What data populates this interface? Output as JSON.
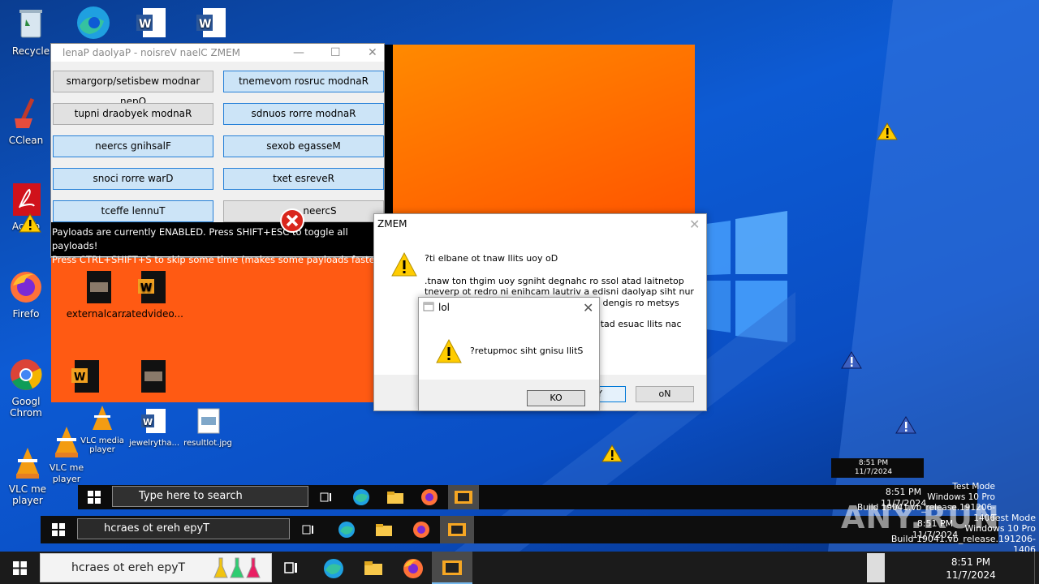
{
  "desktop": {
    "icons": [
      {
        "label": "Recycle"
      },
      {
        "label": "CClean"
      },
      {
        "label": "Acrob"
      },
      {
        "label": "Firefo"
      },
      {
        "label": "Googl Chrom"
      },
      {
        "label": "VLC me player"
      },
      {
        "label": "VLC me player"
      },
      {
        "label": "VLC media player"
      },
      {
        "label": "jewelrytha..."
      },
      {
        "label": "resultlot.jpg"
      }
    ],
    "panel_icons": [
      {
        "label": "externalcar..."
      },
      {
        "label": "ratedvideo..."
      }
    ]
  },
  "panel_window": {
    "title": "lenaP daolyaP - noisreV naelC ZMEM",
    "buttons": [
      "smargorp/setisbew modnar nepO",
      "tnemevom rosruc modnaR",
      "tupni draobyek modnaR",
      "sdnuos rorre modnaR",
      "neercs gnihsalF",
      "sexob egasseM",
      "snoci rorre warD",
      "txet esreveR",
      "tceffe lennuT",
      "neercS"
    ],
    "status_line1": "Payloads are currently ENABLED. Press SHIFT+ESC to toggle all payloads!",
    "status_line2": "Press CTRL+SHIFT+S to skip some time (makes some payloads faster)"
  },
  "memz_dialog": {
    "title": "ZMEM",
    "line1": "?ti elbane ot tnaw llits uoy oD",
    "line2": ".tnaw ton thgim uoy sgniht degnahc ro ssol atad laitnetop",
    "line3": "tneverp ot redro ni enihcam lautriv a edisni daolyap siht nur",
    "line4": "ni dengis ro metsys",
    "line5": "atad esuac llits nac",
    "yes_fragment": "Y",
    "no_label": "oN"
  },
  "lol_dialog": {
    "title": "lol",
    "message": "?retupmoc siht gnisu llitS",
    "ok_label": "KO"
  },
  "taskbars": [
    {
      "search": "Type here to search",
      "time": "8:51 PM",
      "date": "11/7/2024"
    },
    {
      "search": "hcraes ot ereh epyT",
      "time": "8:51 PM",
      "date": "11/7/2024"
    },
    {
      "search": "hcraes ot ereh epyT",
      "time": "8:51 PM",
      "date": "11/7/2024"
    }
  ],
  "mini_clock": {
    "time": "8:51 PM",
    "date": "11/7/2024"
  },
  "watermark": {
    "line1": "Test Mode",
    "line2": "Windows 10 Pro",
    "line3": "Build 19041.vb_release.191206-1406",
    "brand": "ANY.RUN"
  },
  "colors": {
    "accent_blue": "#0078d7",
    "orange": "#ff5a13",
    "warning_yellow": "#ffcc00"
  }
}
